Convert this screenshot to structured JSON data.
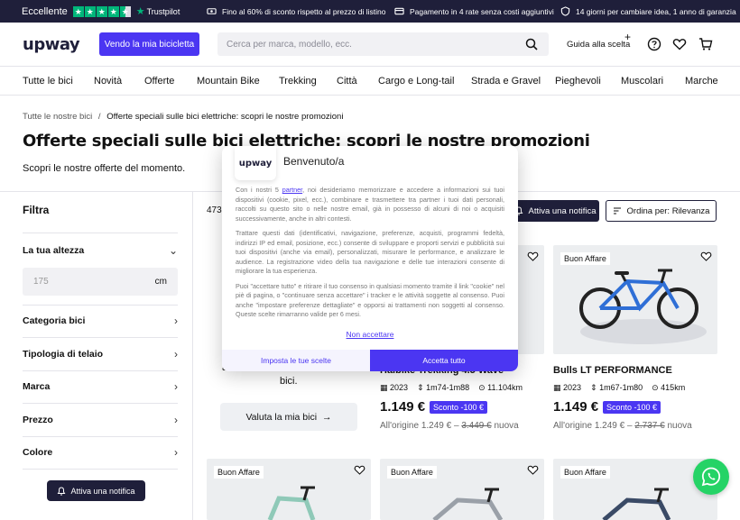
{
  "topbar": {
    "rating_label": "Eccellente",
    "trustpilot": "Trustpilot",
    "promo_discount": "Fino al 60% di sconto rispetto al prezzo di listino",
    "promo_payment": "Pagamento in 4 rate senza costi aggiuntivi",
    "promo_return": "14 giorni per cambiare idea, 1 anno di garanzia"
  },
  "header": {
    "logo": "upway",
    "sell_button": "Vendo la mia bicicletta",
    "search_placeholder": "Cerca per marca, modello, ecc.",
    "guide": "Guida alla scelta"
  },
  "nav": {
    "items": [
      "Tutte le bici",
      "Novità",
      "Offerte",
      "Mountain Bike",
      "Trekking",
      "Città",
      "Cargo e Long-tail",
      "Strada e Gravel",
      "Pieghevoli",
      "Muscolari",
      "Marche"
    ]
  },
  "breadcrumb": {
    "home": "Tutte le nostre bici",
    "sep": "/",
    "current": "Offerte speciali sulle bici elettriche: scopri le nostre promozioni"
  },
  "page": {
    "title": "Offerte speciali sulle bici elettriche: scopri le nostre promozioni",
    "subtitle": "Scopri le nostre offerte del momento."
  },
  "sidebar": {
    "filter_title": "Filtra",
    "height_label": "La tua altezza",
    "height_placeholder": "175",
    "height_unit": "cm",
    "rows": [
      "Categoria bici",
      "Tipologia di telaio",
      "Marca",
      "Prezzo",
      "Colore"
    ],
    "notif_button": "Attiva una notifica"
  },
  "results": {
    "count": "473",
    "notif_button": "Attiva una notifica",
    "sort_button": "Ordina per: Rilevanza"
  },
  "products": [
    {
      "badge": "",
      "name": "Haibike Trekking 4.5 Wave",
      "year": "2023",
      "size": "1m74-1m88",
      "km": "11.104km",
      "price": "1.149 €",
      "discount": "Sconto -100 €",
      "orig_prefix": "All'origine 1.249 € –",
      "orig_new": "3.449 €",
      "orig_suffix": "nuova"
    },
    {
      "badge": "Buon Affare",
      "name": "Bulls LT PERFORMANCE",
      "year": "2023",
      "size": "1m67-1m80",
      "km": "415km",
      "price": "1.149 €",
      "discount": "Sconto -100 €",
      "orig_prefix": "All'origine 1.249 € –",
      "orig_new": "2.737 €",
      "orig_suffix": "nuova"
    }
  ],
  "left_card": {
    "line_a": "a",
    "line_b": "bici.",
    "button": "Valuta la mia bici"
  },
  "bottom_badges": [
    "Buon Affare",
    "Buon Affare",
    "Buon Affare"
  ],
  "modal": {
    "logo": "upway",
    "title": "Benvenuto/a",
    "p1_pre": "Con i nostri 5 ",
    "p1_link": "partner",
    "p1_post": ", noi desideriamo memorizzare e accedere a informazioni sui tuoi dispositivi (cookie, pixel, ecc.), combinare e trasmettere tra partner i tuoi dati personali, raccolti su questo sito o nelle nostre email, già in possesso di alcuni di noi o acquisiti successivamente, anche in altri contesti.",
    "p2": "Trattare questi dati (identificativi, navigazione, preferenze, acquisti, programmi fedeltà, indirizzi IP ed email, posizione, ecc.) consente di sviluppare e proporti servizi e pubblicità sui tuoi dispositivi (anche via email), personalizzati, misurare le performance, e analizzare le audience. La registrazione video della tua navigazione e delle tue interazioni consente di migliorare la tua esperienza.",
    "p3": "Puoi \"accettare tutto\" e ritirare il tuo consenso in qualsiasi momento tramite il link \"cookie\" nel piè di pagina, o \"continuare senza accettare\" i tracker e le attività soggette al consenso. Puoi anche \"impostare preferenze dettagliate\" e opporsi ai trattamenti non soggetti al consenso. Queste scelte rimarranno valide per 6 mesi.",
    "reject": "Non accettare",
    "settings": "Imposta le tue scelte",
    "accept": "Accetta tutto"
  },
  "colors": {
    "accent": "#4b36f2",
    "dark": "#1f1f3a",
    "trustpilot": "#00b67a",
    "whatsapp": "#25d366"
  }
}
